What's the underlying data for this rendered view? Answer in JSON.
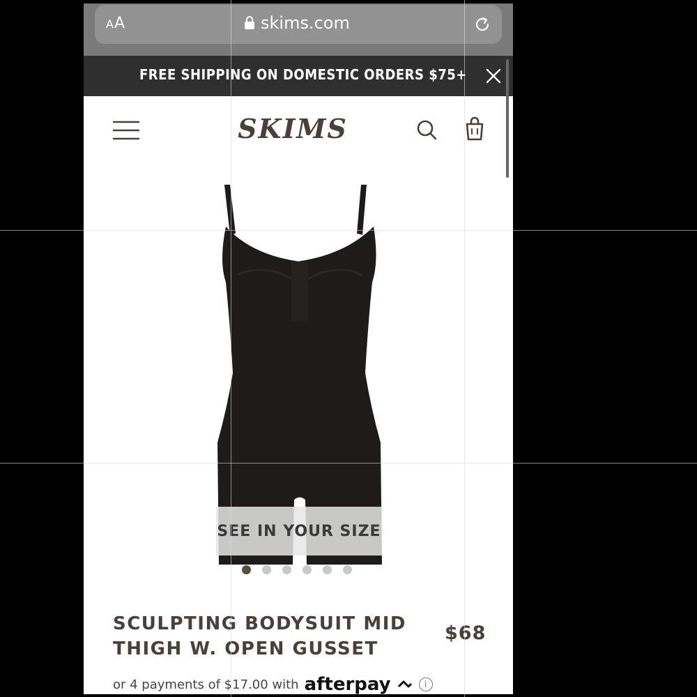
{
  "browser": {
    "text_size_label_small": "A",
    "text_size_label_big": "A",
    "url": "skims.com"
  },
  "promo": {
    "text": "FREE SHIPPING ON DOMESTIC ORDERS $75+"
  },
  "header": {
    "logo": "SKIMS"
  },
  "gallery": {
    "size_overlay": "SEE IN YOUR SIZE",
    "total_images": 6,
    "active_index": 0
  },
  "product": {
    "title": "SCULPTING BODYSUIT MID THIGH W. OPEN GUSSET",
    "price": "$68",
    "installments_text": "or 4 payments of $17.00 with",
    "afterpay_brand": "afterpay",
    "info_glyph": "i"
  },
  "colors": {
    "brand_brown": "#4a4039",
    "promo_bg": "#2f2f2f",
    "product_black": "#1e1b1a"
  }
}
